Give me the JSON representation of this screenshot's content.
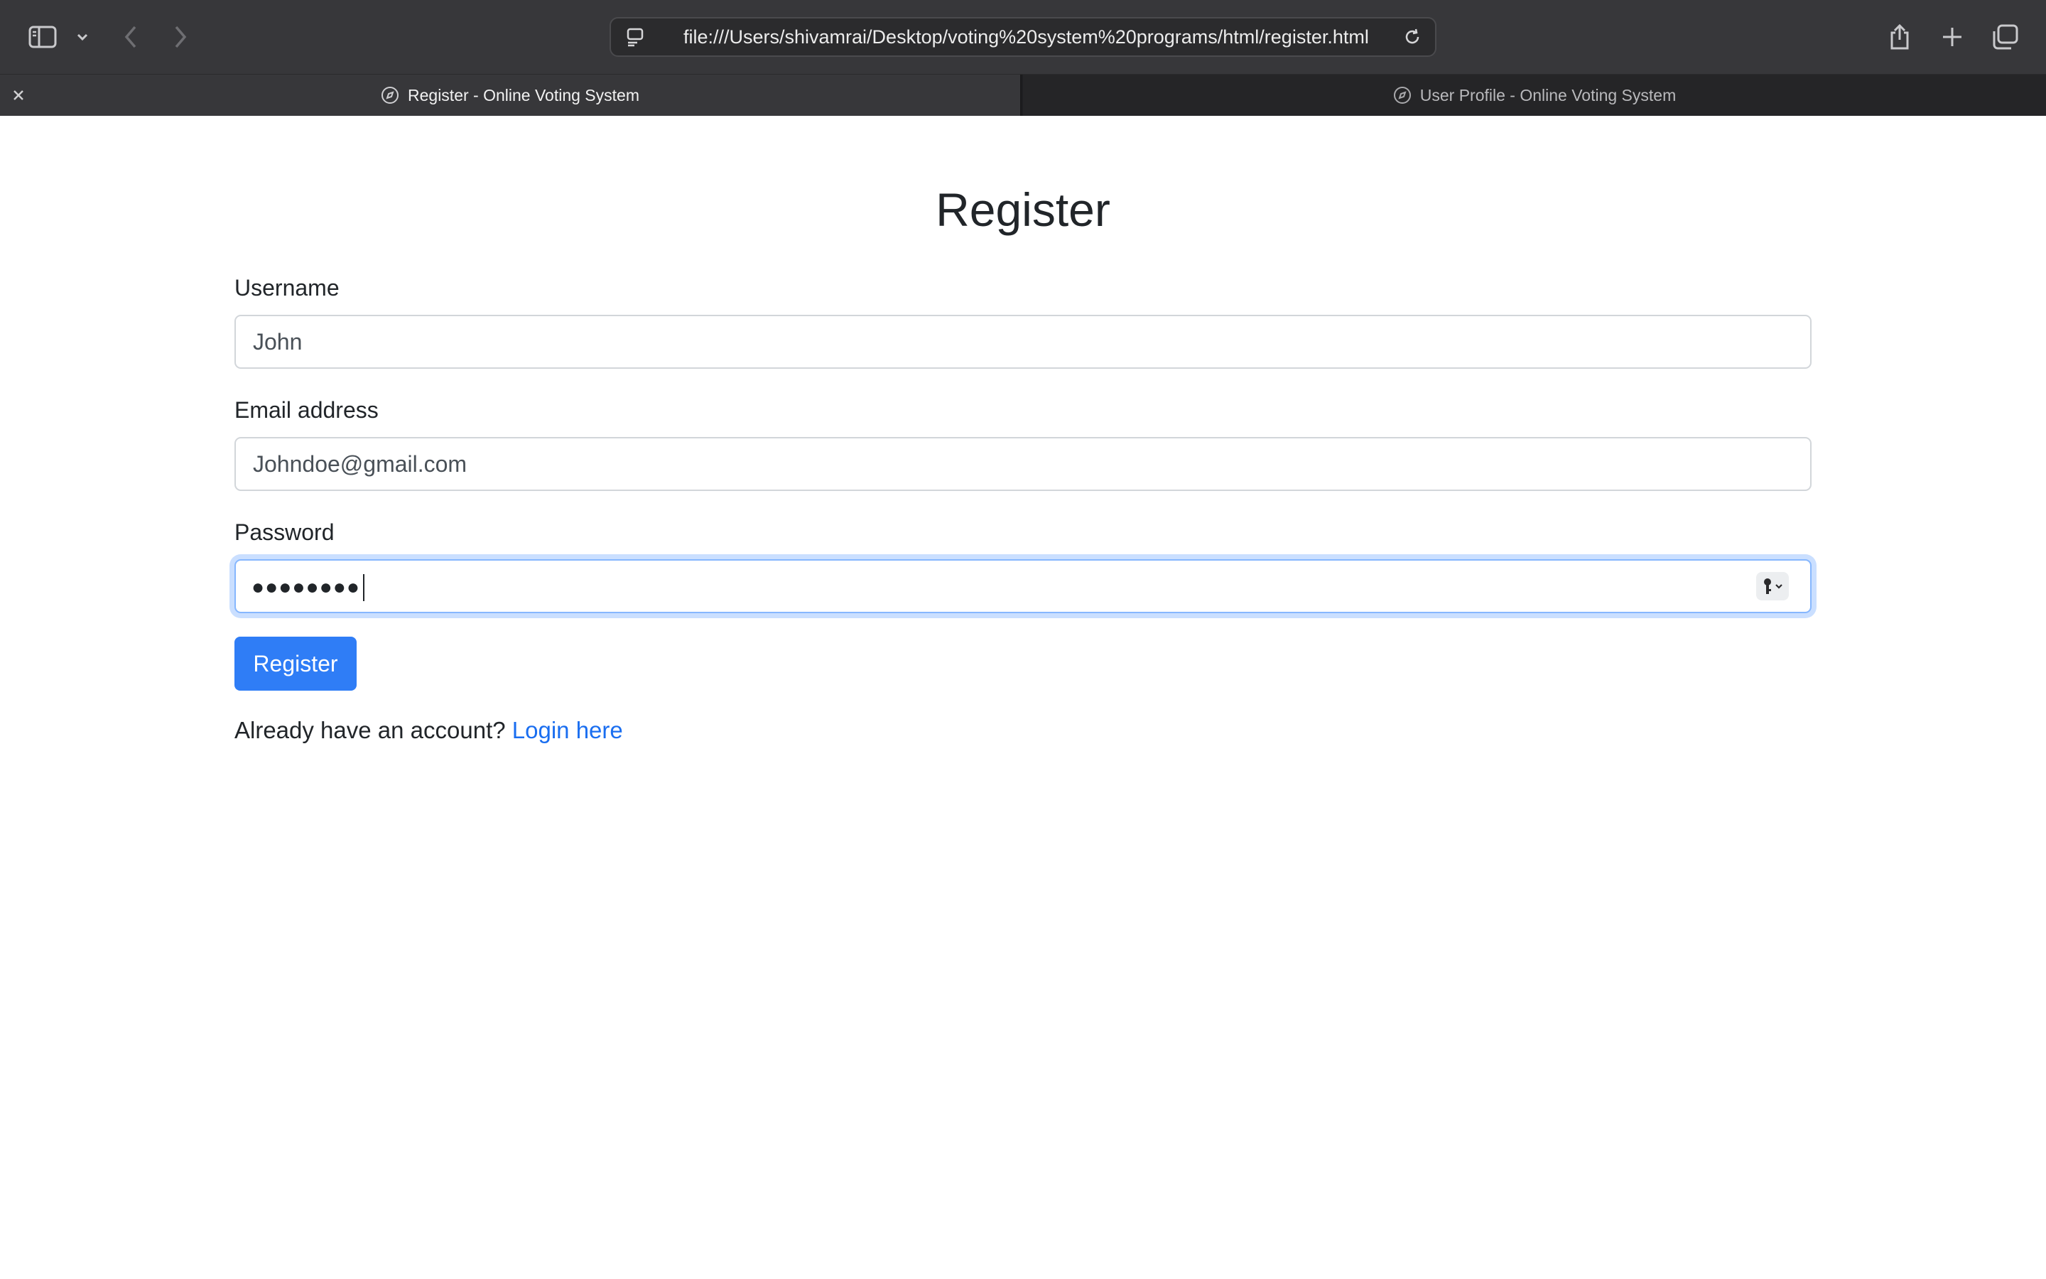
{
  "browser": {
    "url": "file:///Users/shivamrai/Desktop/voting%20system%20programs/html/register.html",
    "tabs": [
      {
        "label": "Register - Online Voting System",
        "active": true
      },
      {
        "label": "User Profile - Online Voting System",
        "active": false
      }
    ],
    "icons": {
      "sidebar": "sidebar-icon",
      "dropdown": "chevron-down-icon",
      "back": "chevron-left-icon",
      "forward": "chevron-right-icon",
      "page_menu": "page-menu-icon",
      "reload": "reload-icon",
      "share": "share-icon",
      "new_tab": "plus-icon",
      "tab_overview": "tab-overview-icon",
      "close_tab": "close-icon",
      "tab_favicon": "compass-icon"
    }
  },
  "page": {
    "title": "Register",
    "form": {
      "username": {
        "label": "Username",
        "value": "John"
      },
      "email": {
        "label": "Email address",
        "value": "Johndoe@gmail.com"
      },
      "password": {
        "label": "Password",
        "masked_value": "●●●●●●●●"
      }
    },
    "submit_label": "Register",
    "footer": {
      "text": "Already have an account?",
      "link_label": "Login here"
    }
  },
  "colors": {
    "primary": "#2f7df6",
    "link": "#1a6ef0",
    "focus_ring": "#86b7fe",
    "chrome_bg": "#37373a"
  }
}
